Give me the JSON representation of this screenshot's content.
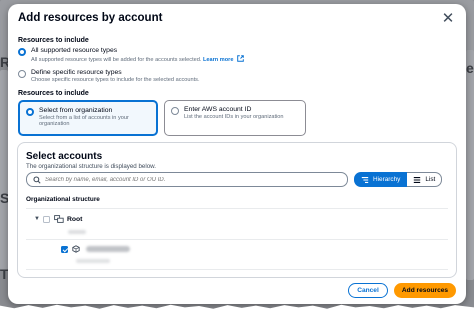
{
  "modal": {
    "title": "Add resources by account",
    "close_icon": "close-icon"
  },
  "resources_include": {
    "label": "Resources to include",
    "options": [
      {
        "label": "All supported resource types",
        "description": "All supported resource types will be added for the accounts selected.",
        "link": "Learn more",
        "selected": true
      },
      {
        "label": "Define specific resource types",
        "description": "Choose specific resource types to include for the selected accounts.",
        "selected": false
      }
    ]
  },
  "resources_to_include": {
    "label": "Resources to include",
    "tiles": [
      {
        "label": "Select from organization",
        "description": "Select from a list of accounts in your organization",
        "selected": true
      },
      {
        "label": "Enter AWS account ID",
        "description": "List the account IDs in your organization",
        "selected": false
      }
    ]
  },
  "select_accounts": {
    "title": "Select accounts",
    "description": "The organizational structure is displayed below.",
    "search_placeholder": "Search by name, email, account ID or OU ID.",
    "view_options": [
      {
        "label": "Hierarchy",
        "icon": "hierarchy-icon",
        "active": true
      },
      {
        "label": "List",
        "icon": "list-icon",
        "active": false
      }
    ],
    "structure_label": "Organizational structure",
    "tree": {
      "root_label": "Root",
      "root_checked": false,
      "child_checked": true
    }
  },
  "footer": {
    "cancel_label": "Cancel",
    "primary_label": "Add resources"
  },
  "colors": {
    "accent": "#0972d3",
    "primary_button": "#ff9900",
    "overlay": "#8a8c91"
  }
}
